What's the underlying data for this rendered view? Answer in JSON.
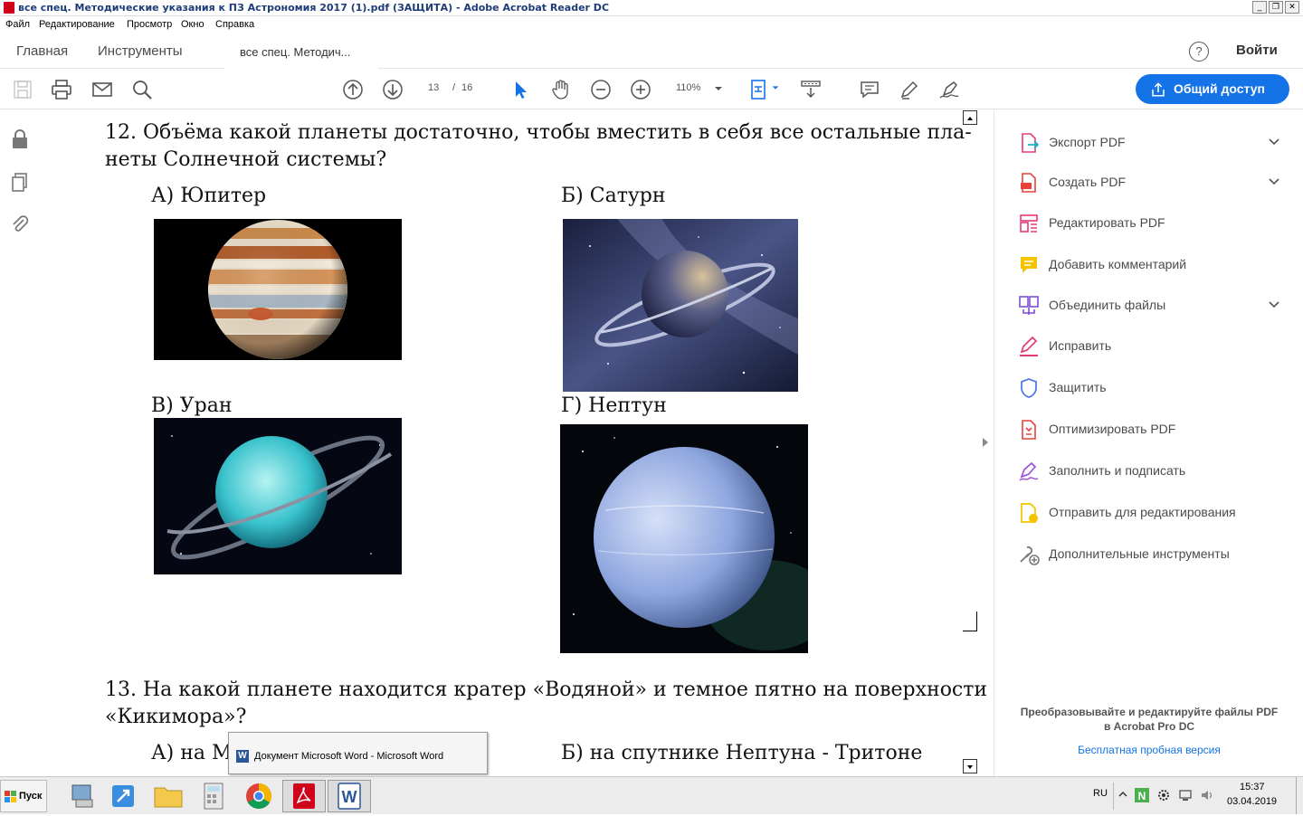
{
  "window": {
    "title": "все спец. Методические указания к ПЗ Астрономия 2017 (1).pdf (ЗАЩИТА) - Adobe Acrobat Reader DC",
    "controls": [
      "_",
      "❐",
      "✕"
    ]
  },
  "menu": [
    "Файл",
    "Редактирование",
    "Просмотр",
    "Окно",
    "Справка"
  ],
  "tabs": {
    "home": "Главная",
    "tools": "Инструменты",
    "document": "все спец. Методич..."
  },
  "header": {
    "help": "?",
    "sign_in": "Войти"
  },
  "toolbar": {
    "page_current": "13",
    "page_sep": "/",
    "page_total": "16",
    "zoom": "110%",
    "share_label": "Общий доступ",
    "accent": "#1473e6"
  },
  "document": {
    "q12_line1": "12. Объёма какой планеты достаточно, чтобы вместить в себя все остальные пла-",
    "q12_line2": "неты Солнечной системы?",
    "opt_a": "А) Юпитер",
    "opt_b": "Б) Сатурн",
    "opt_v": "В) Уран",
    "opt_g": "Г) Нептун",
    "q13_line1": "13. На какой планете находится кратер «Водяной» и темное пятно на поверхности",
    "q13_line2": "«Кикимора»?",
    "q13_opt_a": "А) на М",
    "q13_opt_b": "Б) на спутнике Нептуна - Тритоне"
  },
  "right_panel": {
    "tools": [
      {
        "label": "Экспорт PDF",
        "icon": "export-pdf-icon",
        "color": "#e5397b",
        "chevron": true
      },
      {
        "label": "Создать PDF",
        "icon": "create-pdf-icon",
        "color": "#e8413b",
        "chevron": true
      },
      {
        "label": "Редактировать PDF",
        "icon": "edit-pdf-icon",
        "color": "#e5397b",
        "chevron": false
      },
      {
        "label": "Добавить комментарий",
        "icon": "comment-icon",
        "color": "#f5c400",
        "chevron": false
      },
      {
        "label": "Объединить файлы",
        "icon": "combine-files-icon",
        "color": "#7b4fd8",
        "chevron": true
      },
      {
        "label": "Исправить",
        "icon": "fix-icon",
        "color": "#e5397b",
        "chevron": false
      },
      {
        "label": "Защитить",
        "icon": "protect-icon",
        "color": "#4a74e0",
        "chevron": false
      },
      {
        "label": "Оптимизировать PDF",
        "icon": "optimize-pdf-icon",
        "color": "#e8413b",
        "chevron": false
      },
      {
        "label": "Заполнить и подписать",
        "icon": "fill-sign-icon",
        "color": "#9a50d8",
        "chevron": false
      },
      {
        "label": "Отправить для редактирования",
        "icon": "send-for-edit-icon",
        "color": "#f5c400",
        "chevron": false
      },
      {
        "label": "Дополнительные инструменты",
        "icon": "more-tools-icon",
        "color": "#777777",
        "chevron": false
      }
    ],
    "promo_line1": "Преобразовывайте и редактируйте файлы PDF",
    "promo_line2": "в Acrobat Pro DC",
    "trial_link": "Бесплатная пробная версия"
  },
  "taskbar": {
    "start": "Пуск",
    "popup_text": "Документ Microsoft Word - Microsoft Word",
    "lang": "RU",
    "time": "15:37",
    "date": "03.04.2019"
  }
}
